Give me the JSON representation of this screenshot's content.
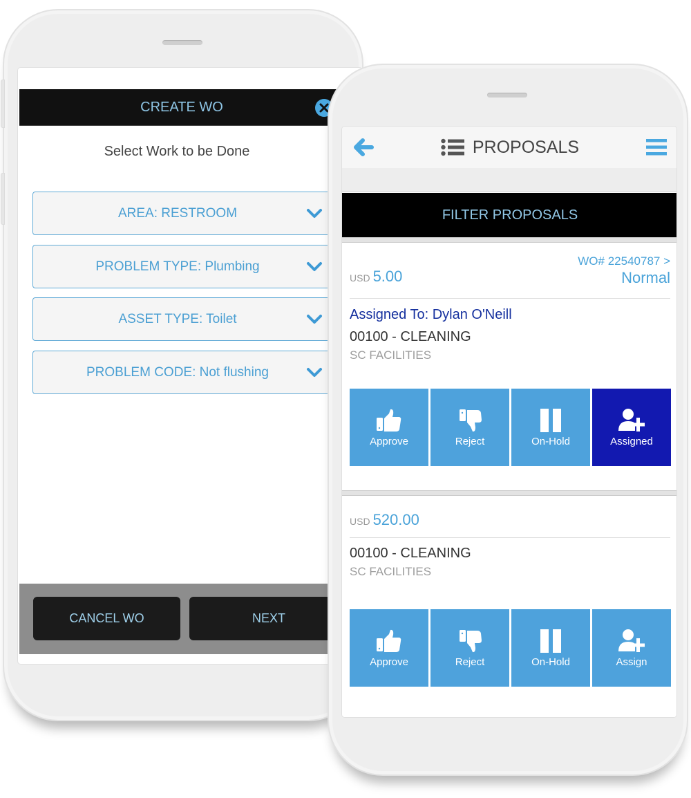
{
  "create_wo": {
    "title": "CREATE WO",
    "close_icon": "close-circle-icon",
    "subtitle": "Select Work to be Done",
    "dropdowns": [
      {
        "label": "AREA: RESTROOM"
      },
      {
        "label": "PROBLEM TYPE: Plumbing"
      },
      {
        "label": "ASSET TYPE: Toilet"
      },
      {
        "label": "PROBLEM CODE: Not flushing"
      }
    ],
    "cancel_label": "CANCEL WO",
    "next_label": "NEXT"
  },
  "proposals": {
    "title": "PROPOSALS",
    "filter_label": "FILTER PROPOSALS",
    "cards": [
      {
        "currency": "USD",
        "amount": "5.00",
        "wo_link": "WO# 22540787 >",
        "priority": "Normal",
        "assigned_to": "Assigned To: Dylan O'Neill",
        "code": "00100 - CLEANING",
        "org": "SC FACILITIES",
        "actions": [
          {
            "label": "Approve",
            "icon": "thumbs-up-icon",
            "active": false
          },
          {
            "label": "Reject",
            "icon": "thumbs-down-icon",
            "active": false
          },
          {
            "label": "On-Hold",
            "icon": "pause-icon",
            "active": false
          },
          {
            "label": "Assigned",
            "icon": "user-plus-icon",
            "active": true
          }
        ]
      },
      {
        "currency": "USD",
        "amount": "520.00",
        "code": "00100 - CLEANING",
        "org": "SC FACILITIES",
        "actions": [
          {
            "label": "Approve",
            "icon": "thumbs-up-icon",
            "active": false
          },
          {
            "label": "Reject",
            "icon": "thumbs-down-icon",
            "active": false
          },
          {
            "label": "On-Hold",
            "icon": "pause-icon",
            "active": false
          },
          {
            "label": "Assign",
            "icon": "user-plus-icon",
            "active": false
          }
        ]
      }
    ]
  },
  "colors": {
    "accent": "#4ea2dc",
    "active_action": "#1219b0",
    "header_bg": "#111111",
    "assigned_text": "#15309e"
  }
}
